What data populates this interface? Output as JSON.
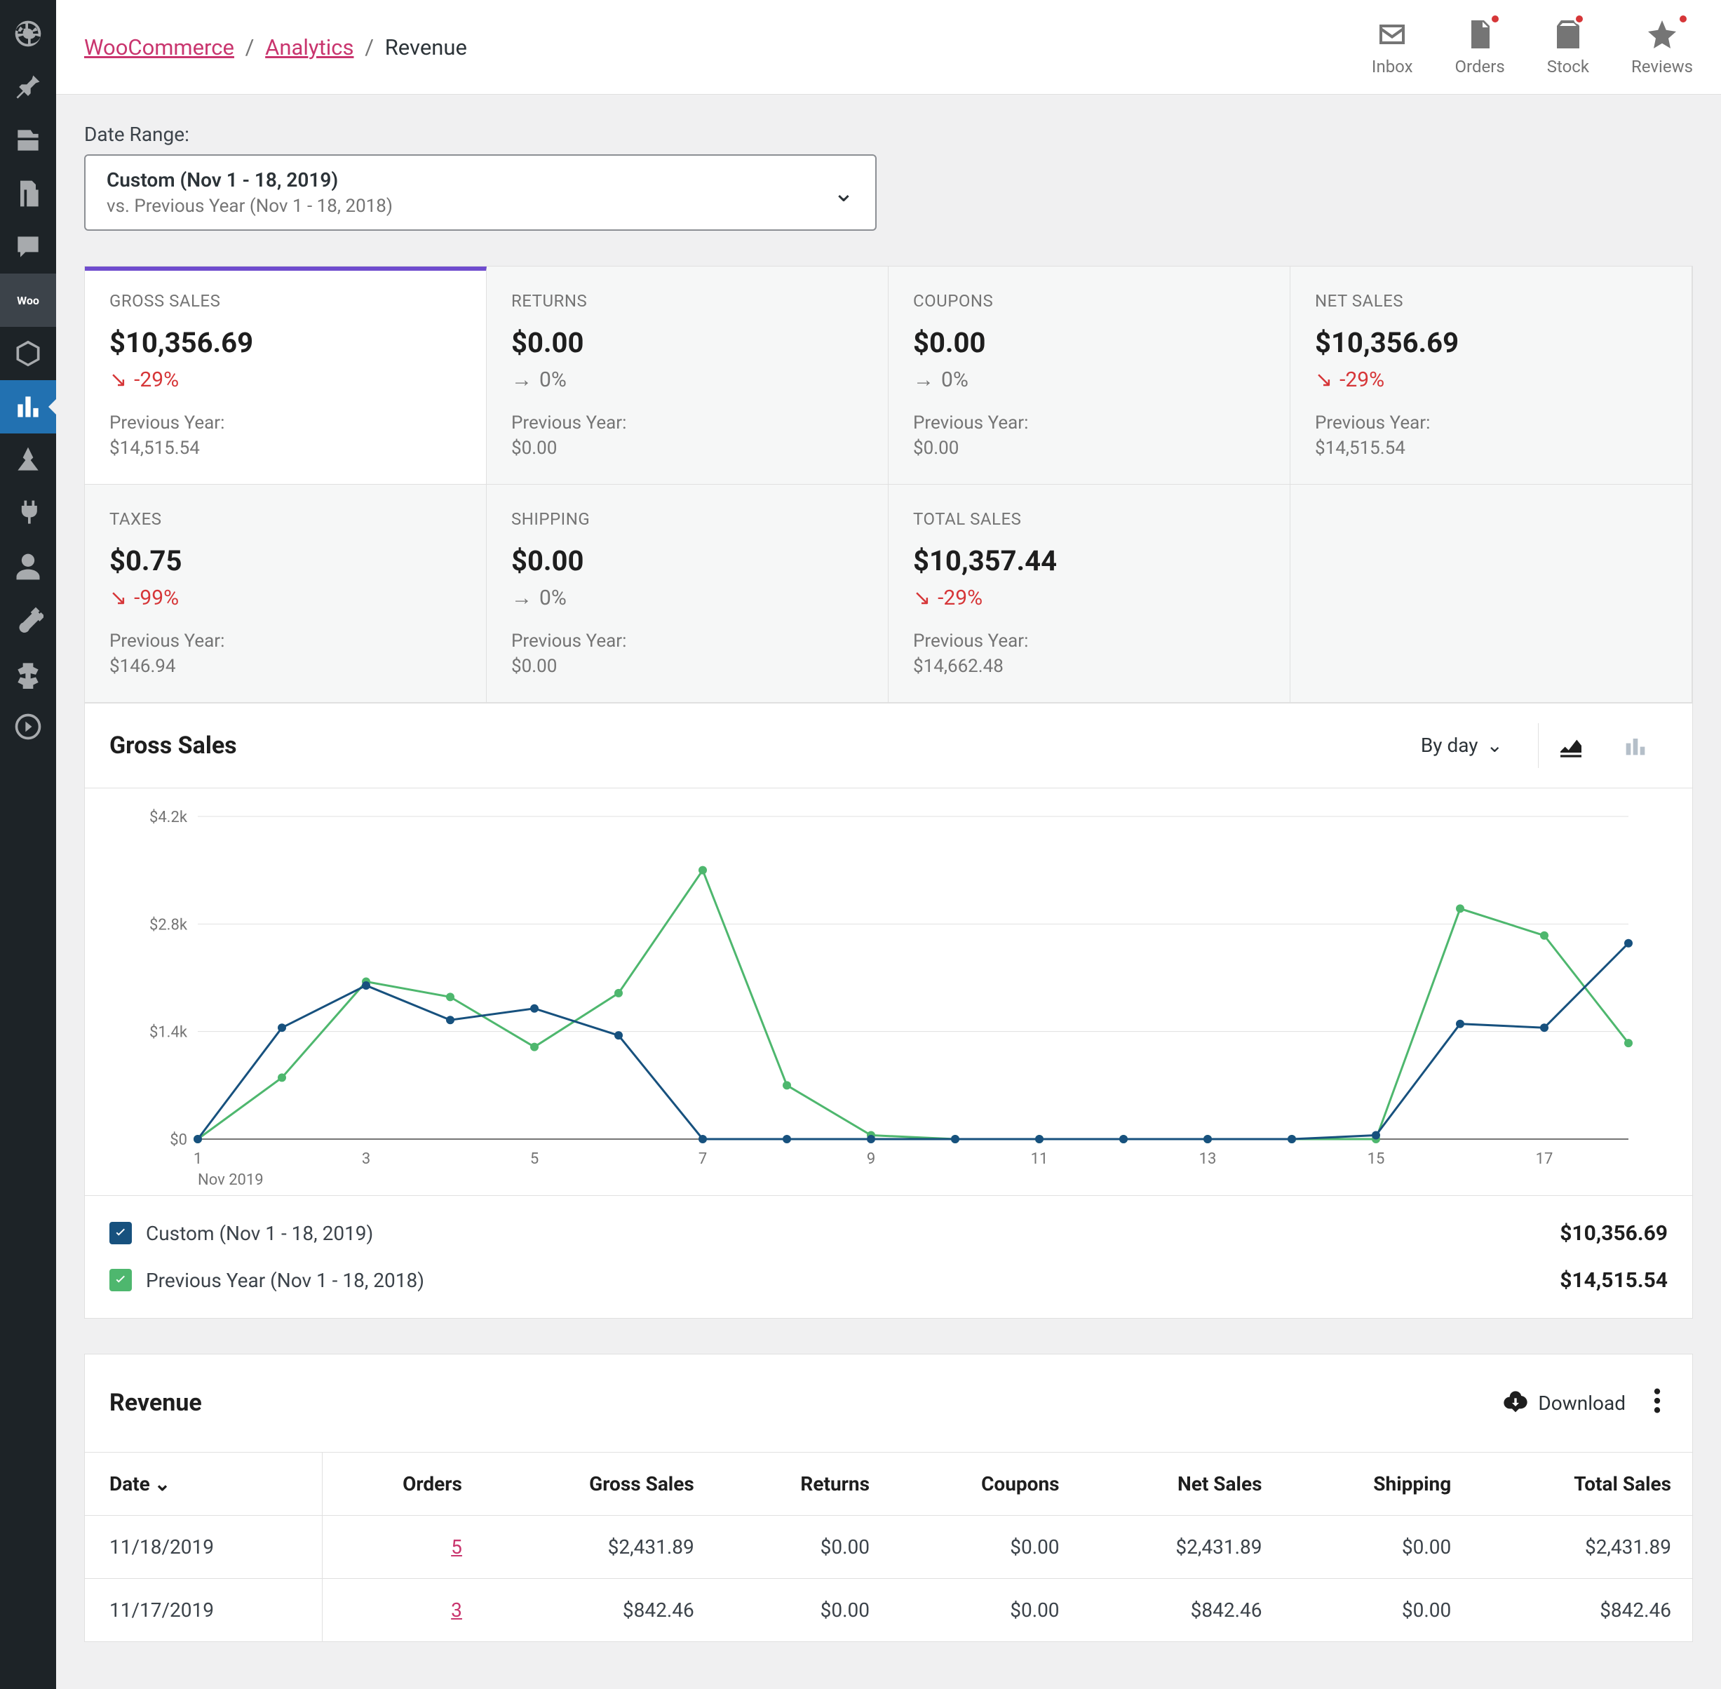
{
  "breadcrumbs": [
    "WooCommerce",
    "Analytics",
    "Revenue"
  ],
  "activity": [
    {
      "label": "Inbox",
      "badge": false
    },
    {
      "label": "Orders",
      "badge": true
    },
    {
      "label": "Stock",
      "badge": true
    },
    {
      "label": "Reviews",
      "badge": true
    }
  ],
  "dateRange": {
    "label": "Date Range:",
    "primary": "Custom (Nov 1 - 18, 2019)",
    "secondary": "vs. Previous Year (Nov 1 - 18, 2018)"
  },
  "summary": [
    {
      "key": "gross-sales",
      "label": "GROSS SALES",
      "value": "$10,356.69",
      "delta": "-29%",
      "trend": "neg",
      "prevLabel": "Previous Year:",
      "prev": "$14,515.54",
      "active": true
    },
    {
      "key": "returns",
      "label": "RETURNS",
      "value": "$0.00",
      "delta": "0%",
      "trend": "flat",
      "prevLabel": "Previous Year:",
      "prev": "$0.00"
    },
    {
      "key": "coupons",
      "label": "COUPONS",
      "value": "$0.00",
      "delta": "0%",
      "trend": "flat",
      "prevLabel": "Previous Year:",
      "prev": "$0.00"
    },
    {
      "key": "net-sales",
      "label": "NET SALES",
      "value": "$10,356.69",
      "delta": "-29%",
      "trend": "neg",
      "prevLabel": "Previous Year:",
      "prev": "$14,515.54"
    },
    {
      "key": "taxes",
      "label": "TAXES",
      "value": "$0.75",
      "delta": "-99%",
      "trend": "neg",
      "prevLabel": "Previous Year:",
      "prev": "$146.94"
    },
    {
      "key": "shipping",
      "label": "SHIPPING",
      "value": "$0.00",
      "delta": "0%",
      "trend": "flat",
      "prevLabel": "Previous Year:",
      "prev": "$0.00"
    },
    {
      "key": "total-sales",
      "label": "TOTAL SALES",
      "value": "$10,357.44",
      "delta": "-29%",
      "trend": "neg",
      "prevLabel": "Previous Year:",
      "prev": "$14,662.48"
    },
    {
      "empty": true
    }
  ],
  "chart": {
    "title": "Gross Sales",
    "interval": "By day",
    "legend": [
      {
        "label": "Custom (Nov 1 - 18, 2019)",
        "value": "$10,356.69"
      },
      {
        "label": "Previous Year (Nov 1 - 18, 2018)",
        "value": "$14,515.54"
      }
    ]
  },
  "chart_data": {
    "type": "line",
    "title": "Gross Sales",
    "xlabel": "Nov 2019",
    "ylabel": "",
    "ylim": [
      0,
      4200
    ],
    "yticks": [
      0,
      1400,
      2800,
      4200
    ],
    "yticklabels": [
      "$0",
      "$1.4k",
      "$2.8k",
      "$4.2k"
    ],
    "x": [
      1,
      2,
      3,
      4,
      5,
      6,
      7,
      8,
      9,
      10,
      11,
      12,
      13,
      14,
      15,
      16,
      17,
      18
    ],
    "xticks": [
      1,
      3,
      5,
      7,
      9,
      11,
      13,
      15,
      17
    ],
    "series": [
      {
        "name": "Custom (Nov 1 - 18, 2019)",
        "color": "#17517e",
        "values": [
          0,
          1450,
          2000,
          1550,
          1700,
          1350,
          0,
          0,
          0,
          0,
          0,
          0,
          0,
          0,
          50,
          1500,
          1450,
          2550
        ]
      },
      {
        "name": "Previous Year (Nov 1 - 18, 2018)",
        "color": "#4eb76e",
        "values": [
          0,
          800,
          2050,
          1850,
          1200,
          1900,
          3500,
          700,
          50,
          0,
          0,
          0,
          0,
          0,
          0,
          3000,
          2650,
          1250
        ]
      }
    ]
  },
  "table": {
    "title": "Revenue",
    "download": "Download",
    "columns": [
      "Date",
      "Orders",
      "Gross Sales",
      "Returns",
      "Coupons",
      "Net Sales",
      "Shipping",
      "Total Sales"
    ],
    "sortCol": 0,
    "rows": [
      {
        "date": "11/18/2019",
        "orders": "5",
        "gross": "$2,431.89",
        "returns": "$0.00",
        "coupons": "$0.00",
        "net": "$2,431.89",
        "shipping": "$0.00",
        "total": "$2,431.89"
      },
      {
        "date": "11/17/2019",
        "orders": "3",
        "gross": "$842.46",
        "returns": "$0.00",
        "coupons": "$0.00",
        "net": "$842.46",
        "shipping": "$0.00",
        "total": "$842.46"
      }
    ]
  }
}
